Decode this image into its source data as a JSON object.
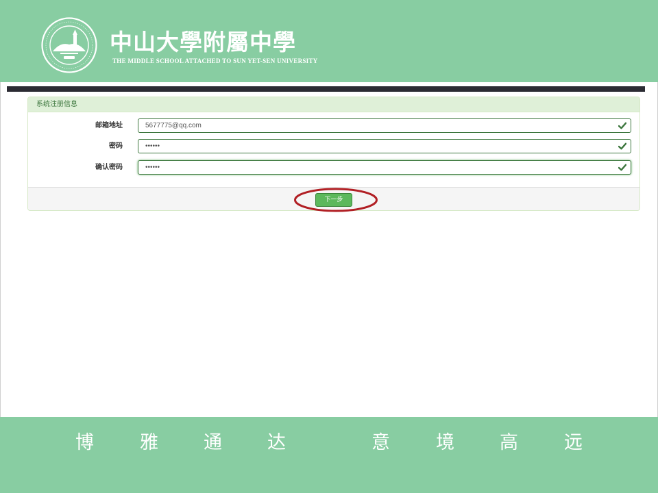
{
  "header": {
    "school_name_cn": "中山大學附屬中學",
    "school_name_en": "THE MIDDLE SCHOOL ATTACHED TO  SUN YET-SEN UNIVERSITY",
    "logo_icon": "school-seal-icon",
    "background_color": "#88cda2"
  },
  "form": {
    "title": "系统注册信息",
    "fields": [
      {
        "label": "邮箱地址",
        "value": "5677775@qq.com",
        "status_icon": "check-icon"
      },
      {
        "label": "密码",
        "value": "••••••",
        "status_icon": "check-icon"
      },
      {
        "label": "确认密码",
        "value": "••••••",
        "status_icon": "check-icon"
      }
    ],
    "next_label": "下一步",
    "accent_color": "#3c763d",
    "button_color": "#5cb85c",
    "highlight_color": "#b11f24"
  },
  "footer": {
    "motto": [
      "博",
      "雅",
      "通",
      "达",
      "意",
      "境",
      "高",
      "远"
    ],
    "background_color": "#88cda2"
  }
}
